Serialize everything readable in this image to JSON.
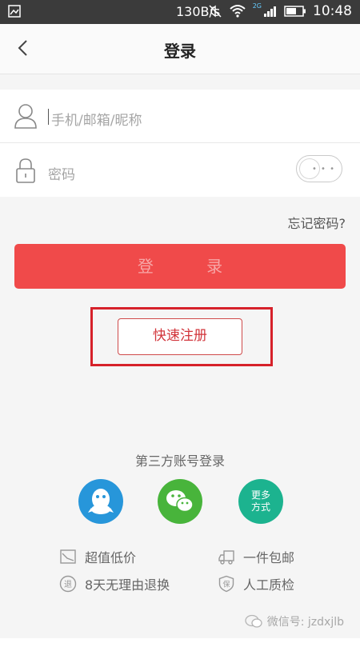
{
  "status_bar": {
    "net_speed": "130B/s",
    "network_badge": "2G",
    "time": "10:48"
  },
  "nav": {
    "title": "登录"
  },
  "form": {
    "account_placeholder": "手机/邮箱/昵称",
    "password_placeholder": "密码",
    "password_toggle_dots": "• • •"
  },
  "forgot_password": "忘记密码?",
  "login_button": "登 录",
  "register_button": "快速注册",
  "third_party": {
    "title": "第三方账号登录",
    "more_label_line1": "更多",
    "more_label_line2": "方式"
  },
  "features": [
    {
      "label": "超值低价",
      "icon": "price-tag-icon"
    },
    {
      "label": "一件包邮",
      "icon": "truck-icon"
    },
    {
      "label": "8天无理由退换",
      "icon": "return-icon"
    },
    {
      "label": "人工质检",
      "icon": "quality-shield-icon"
    }
  ],
  "watermark": "微信号: jzdxjlb",
  "colors": {
    "accent_red": "#f04a4a",
    "register_text": "#d2353b",
    "highlight_border": "#d6212a",
    "qq_blue": "#2796da",
    "wechat_green": "#48b43b",
    "more_teal": "#1cb38f"
  }
}
